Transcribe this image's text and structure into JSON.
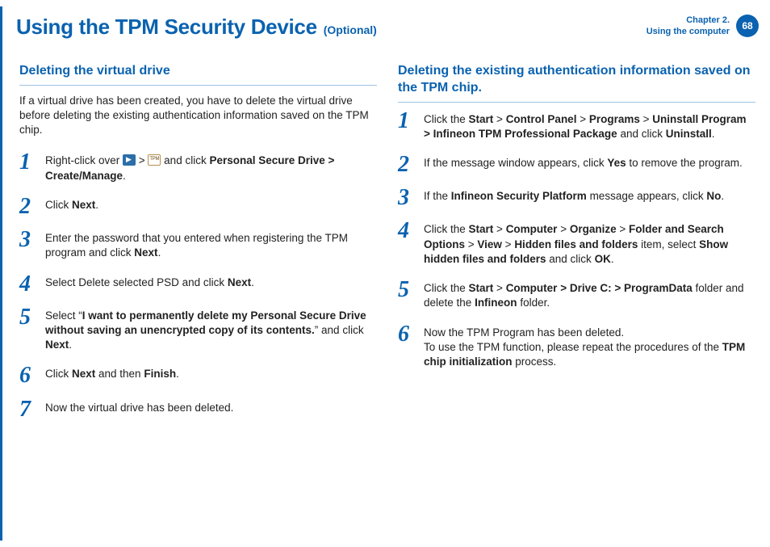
{
  "header": {
    "title": "Using the TPM Security Device",
    "subtitle": "(Optional)",
    "chapter_line1": "Chapter 2.",
    "chapter_line2": "Using the computer",
    "page": "68"
  },
  "left": {
    "section_title": "Deleting the virtual drive",
    "intro": "If a virtual drive has been created, you have to delete the virtual drive before deleting the existing authentication information saved on the TPM chip.",
    "steps": [
      {
        "num": "1",
        "html": "Right-click over <span class='inline-icon' data-name='taskbar-icon' data-interactable='false'></span> > <span class='inline-icon tpm' data-name='tpm-icon' data-interactable='false'></span> and click <b>Personal Secure Drive > Create/Manage</b>."
      },
      {
        "num": "2",
        "html": "Click <b>Next</b>."
      },
      {
        "num": "3",
        "html": "Enter the password that you entered when registering the TPM program and click <b>Next</b>."
      },
      {
        "num": "4",
        "html": "Select Delete selected PSD and click <b>Next</b>."
      },
      {
        "num": "5",
        "html": "Select “<b>I want to permanently delete my Personal Secure Drive without saving an unencrypted copy of its contents.</b>” and click <b>Next</b>."
      },
      {
        "num": "6",
        "html": "Click <b>Next</b> and then <b>Finish</b>."
      },
      {
        "num": "7",
        "html": "Now the virtual drive has been deleted."
      }
    ]
  },
  "right": {
    "section_title": "Deleting the existing authentication information saved on the TPM chip.",
    "steps": [
      {
        "num": "1",
        "html": "Click the <b>Start</b> > <b>Control Panel</b> > <b>Programs</b> > <b>Uninstall Program > Infineon TPM Professional Package</b> and click <b>Uninstall</b>."
      },
      {
        "num": "2",
        "html": "If the message window appears, click <b>Yes</b> to remove the program."
      },
      {
        "num": "3",
        "html": "If the <b>Infineon Security Platform</b> message appears, click <b>No</b>."
      },
      {
        "num": "4",
        "html": "Click the <b>Start</b> > <b>Computer</b> > <b>Organize</b> > <b>Folder and Search Options</b> > <b>View</b> > <b>Hidden files and folders</b> item, select <b>Show hidden files and folders</b> and click <b>OK</b>."
      },
      {
        "num": "5",
        "html": "Click the <b>Start</b> > <b>Computer > Drive C: > ProgramData</b> folder and delete the <b>Infineon</b> folder."
      },
      {
        "num": "6",
        "html": "Now the TPM Program has been deleted.<br>To use the TPM function, please repeat the procedures of the <b>TPM chip initialization</b> process."
      }
    ]
  }
}
